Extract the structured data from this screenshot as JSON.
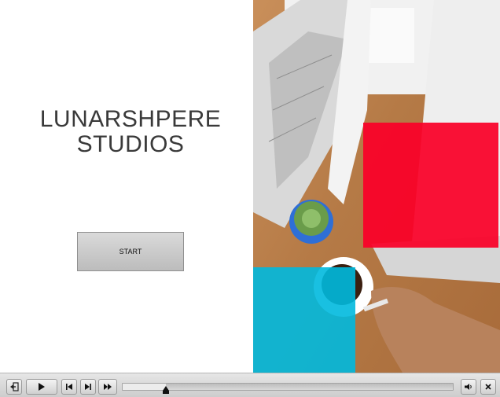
{
  "slide": {
    "title_lines": [
      "LUNARSHPERE",
      "STUDIOS"
    ],
    "start_label": "START",
    "colors": {
      "red_accent": "#fa0028",
      "cyan_accent": "#00b9de",
      "title_text": "#3a3a3a"
    }
  },
  "photo": {
    "description_icon": "workspace-photo"
  },
  "controlbar": {
    "buttons": [
      {
        "icon": "exit-icon"
      },
      {
        "icon": "play-icon"
      },
      {
        "icon": "previous-icon"
      },
      {
        "icon": "next-icon"
      },
      {
        "icon": "fast-forward-icon"
      },
      {
        "icon": "volume-icon"
      },
      {
        "icon": "close-icon"
      }
    ],
    "progress": 0.13
  }
}
